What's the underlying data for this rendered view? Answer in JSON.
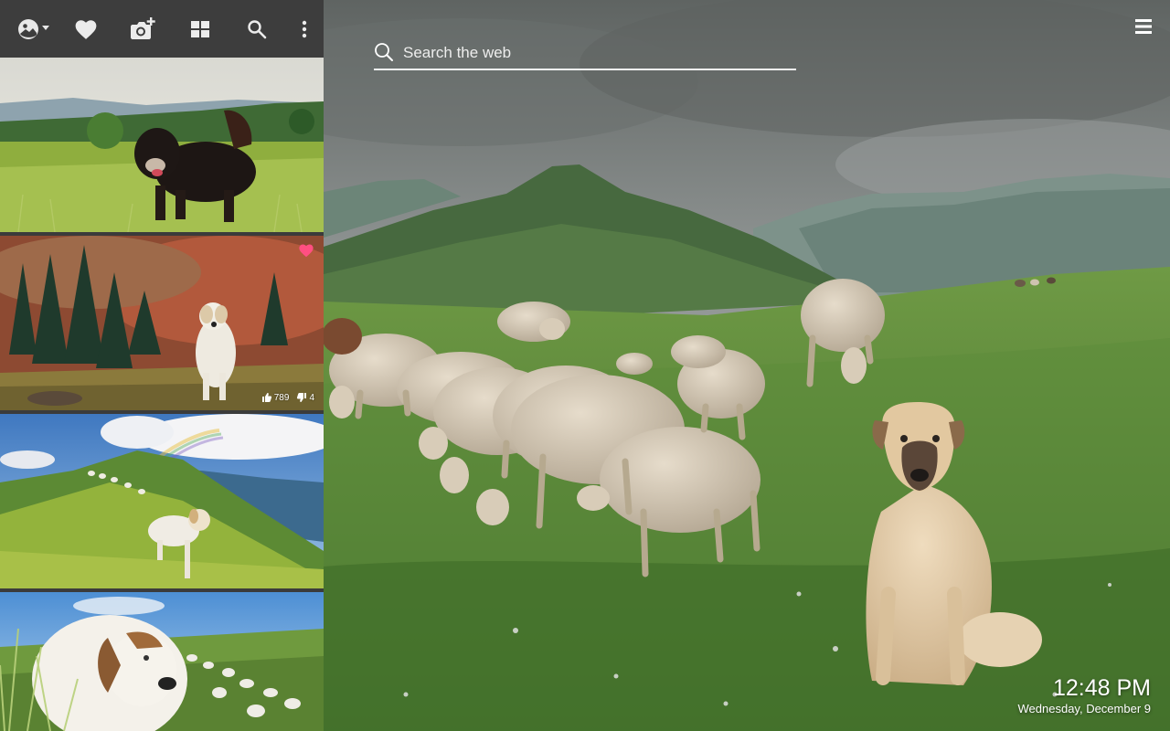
{
  "toolbar": {
    "items": [
      {
        "icon": "wallpaper-switch-icon"
      },
      {
        "icon": "heart-icon"
      },
      {
        "icon": "add-photo-icon"
      },
      {
        "icon": "grid-icon"
      },
      {
        "icon": "search-icon"
      },
      {
        "icon": "more-vert-icon"
      }
    ]
  },
  "thumbnails": [
    {
      "favorite": false
    },
    {
      "favorite": true,
      "likes": "789",
      "dislikes": "4"
    },
    {
      "favorite": false
    },
    {
      "favorite": false
    }
  ],
  "search": {
    "placeholder": "Search the web",
    "value": ""
  },
  "clock": {
    "time": "12:48 PM",
    "date": "Wednesday, December 9"
  },
  "colors": {
    "favorite_heart": "#ff4f81",
    "panel_bg": "#3d3d3d",
    "text": "#ffffff"
  }
}
